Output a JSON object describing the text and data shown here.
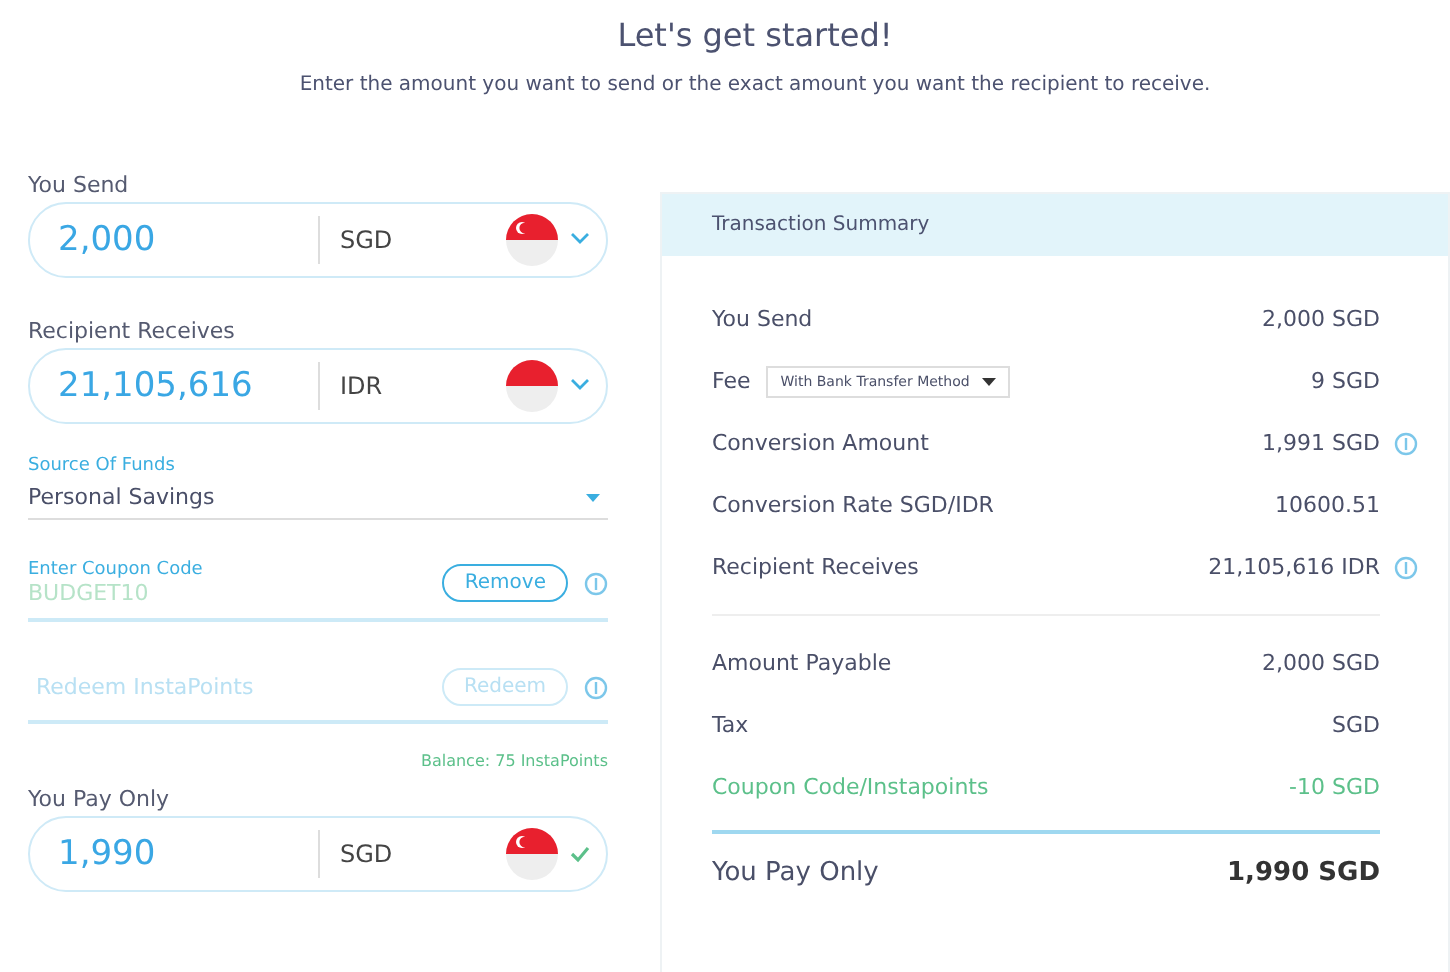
{
  "header": {
    "title": "Let's get started!",
    "subtitle": "Enter the amount you want to send or the exact amount you want the recipient to receive."
  },
  "form": {
    "send": {
      "label": "You Send",
      "amount": "2,000",
      "currency": "SGD",
      "emblem": true,
      "confirmed": false
    },
    "receive": {
      "label": "Recipient Receives",
      "amount": "21,105,616",
      "currency": "IDR",
      "emblem": false,
      "confirmed": false
    },
    "source": {
      "label": "Source Of Funds",
      "value": "Personal Savings"
    },
    "coupon": {
      "label": "Enter Coupon Code",
      "value": "BUDGET10",
      "button": "Remove",
      "disabled": false
    },
    "points": {
      "placeholder": "Redeem InstaPoints",
      "button": "Redeem",
      "disabled": true
    },
    "balance": "Balance: 75 InstaPoints",
    "pay": {
      "label": "You Pay Only",
      "amount": "1,990",
      "currency": "SGD",
      "emblem": true,
      "confirmed": true
    }
  },
  "summary": {
    "title": "Transaction Summary",
    "groups": [
      {
        "rows": [
          {
            "kind": "text",
            "label": "You Send",
            "value": "2,000 SGD",
            "info": false
          },
          {
            "kind": "select",
            "label": "Fee",
            "option": "With Bank Transfer Method",
            "value": "9 SGD",
            "info": false
          },
          {
            "kind": "text",
            "label": "Conversion Amount",
            "value": "1,991 SGD",
            "info": true
          },
          {
            "kind": "text",
            "label": "Conversion Rate SGD/IDR",
            "value": "10600.51",
            "info": false
          },
          {
            "kind": "text",
            "label": "Recipient Receives",
            "value": "21,105,616 IDR",
            "info": true
          }
        ]
      },
      {
        "rows": [
          {
            "kind": "text",
            "label": "Amount Payable",
            "value": "2,000 SGD",
            "info": false
          },
          {
            "kind": "text",
            "label": "Tax",
            "value": "SGD",
            "info": false
          },
          {
            "kind": "discount",
            "label": "Coupon Code/Instapoints",
            "value": "-10 SGD",
            "info": false
          }
        ]
      },
      {
        "rows": [
          {
            "kind": "total",
            "label": "You Pay Only",
            "value": "1,990 SGD",
            "info": false
          }
        ]
      }
    ]
  }
}
